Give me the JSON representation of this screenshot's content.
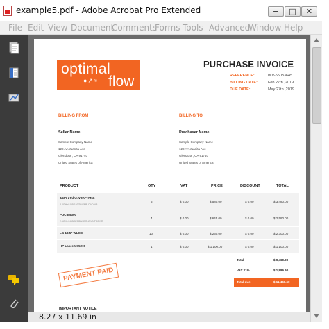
{
  "window": {
    "title": "example5.pdf - Adobe Acrobat Pro Extended",
    "controls": [
      "−",
      "□",
      "✕"
    ]
  },
  "menu": [
    "File",
    "Edit",
    "View",
    "Document",
    "Comments",
    "Forms",
    "Tools",
    "Advanced",
    "Window",
    "Help"
  ],
  "status": {
    "page_size": "8.27 x 11.69 in"
  },
  "invoice": {
    "logo_top": "optimal",
    "logo_bottom": "flow",
    "title": "PURCHASE INVOICE",
    "meta": [
      {
        "label": "REFERENCE:",
        "value": "INV-55033645"
      },
      {
        "label": "BILLING DATE:",
        "value": "Feb 27th ,2019"
      },
      {
        "label": "DUE DATE:",
        "value": "May 27th ,2019"
      }
    ],
    "billing_from": {
      "heading": "BILLING FROM",
      "name": "Seller Name",
      "lines": [
        "Sample Company Name",
        "128 AA Juanita Ave",
        "Glendora , CA 91740",
        "United States of America"
      ]
    },
    "billing_to": {
      "heading": "BILLING TO",
      "name": "Purchaser Name",
      "lines": [
        "Sample Company Name",
        "128 AA Juanita Ave",
        "Glendora , CA 91740",
        "United States of America"
      ]
    },
    "columns": [
      "PRODUCT",
      "QTY",
      "VAT",
      "PRICE",
      "DISCOUNT",
      "TOTAL"
    ],
    "rows": [
      {
        "product": "AMD Athlon X2DC-7450",
        "sub": "2.4GHz/1GB/160GB/SMP-DVD/VB",
        "qty": "6",
        "vat": "$ 0.00",
        "price": "$ 580.00",
        "discount": "$ 0.00",
        "total": "$ 3,480.00"
      },
      {
        "product": "PDC-E5300",
        "sub": "2.6GHz/1GB/320GB/SMP-DVD/FDD/VB",
        "qty": "4",
        "vat": "$ 0.00",
        "price": "$ 645.00",
        "discount": "$ 0.00",
        "total": "$ 2,580.00"
      },
      {
        "product": "LG 18.5\" WLCD",
        "sub": "",
        "qty": "10",
        "vat": "$ 0.00",
        "price": "$ 230.00",
        "discount": "$ 0.00",
        "total": "$ 2,300.00"
      },
      {
        "product": "HP LaserJet 5200",
        "sub": "",
        "qty": "1",
        "vat": "$ 0.00",
        "price": "$ 1,100.00",
        "discount": "$ 0.00",
        "total": "$ 1,100.00"
      }
    ],
    "totals": [
      {
        "label": "Total",
        "value": "$ 9,460.00"
      },
      {
        "label": "VAT 21%",
        "value": "$ 1,986.60"
      },
      {
        "label": "Total due",
        "value": "$ 11,446.60"
      }
    ],
    "stamp": "PAYMENT PAID",
    "notice": "IMPORTANT NOTICE"
  },
  "colors": {
    "accent": "#f26522",
    "nav": "#3b3b3b",
    "doc_bg": "#6a6a6a"
  }
}
